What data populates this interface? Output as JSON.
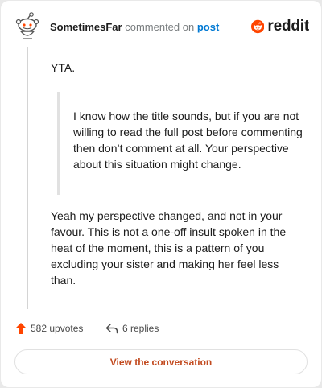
{
  "header": {
    "username": "SometimesFar",
    "action": "commented on",
    "target": "post"
  },
  "brand": {
    "name": "reddit",
    "color": "#ff4500"
  },
  "comment": {
    "opening": "YTA.",
    "quote": "I know how the title sounds, but if you are not willing to read the full post before commenting then don’t comment at all. Your perspective about this situation might change.",
    "reply": "Yeah my perspective changed, and not in your favour. This is not a one-off insult spoken in the heat of the moment, this is a pattern of you excluding your sister and making her feel less than."
  },
  "actions": {
    "upvotes": "582 upvotes",
    "replies": "6 replies"
  },
  "cta": {
    "label": "View the conversation"
  }
}
